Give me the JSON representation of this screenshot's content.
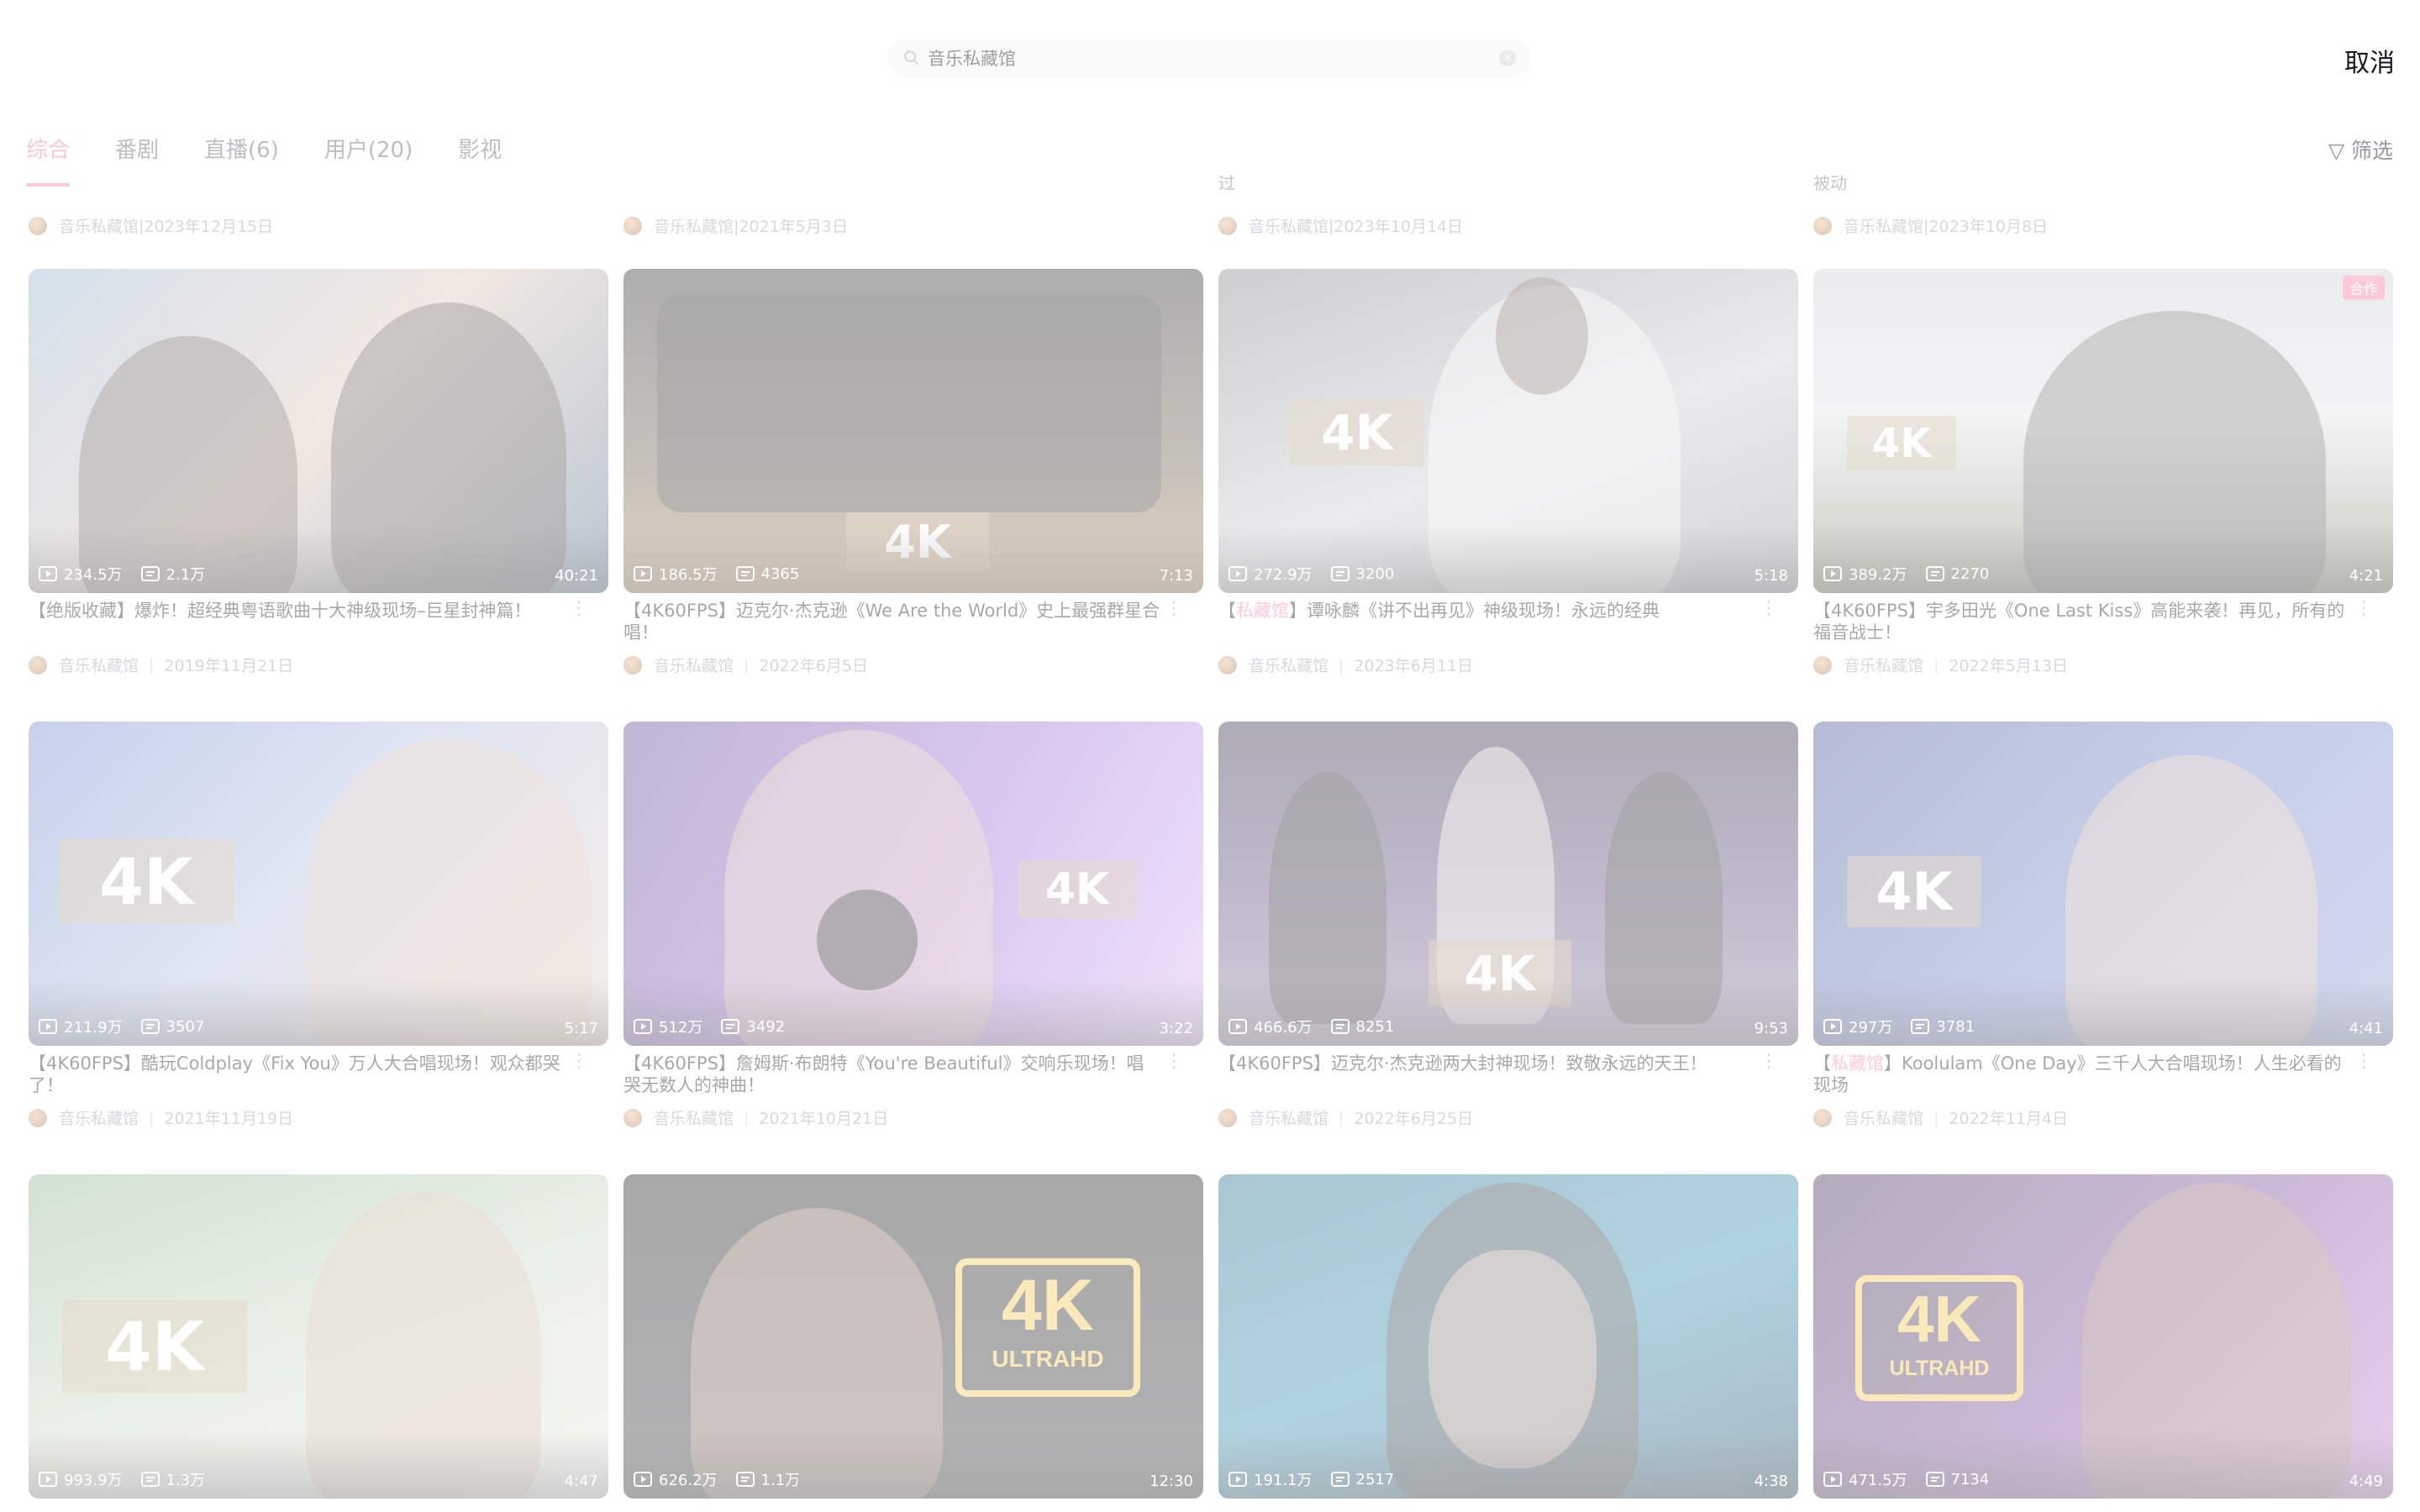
{
  "search": {
    "query": "音乐私藏馆",
    "cancel_label": "取消"
  },
  "tabs": [
    {
      "label": "综合",
      "active": true
    },
    {
      "label": "番剧"
    },
    {
      "label": "直播(6)"
    },
    {
      "label": "用户(20)"
    },
    {
      "label": "影视"
    }
  ],
  "filter_label": "▽ 筛选",
  "previous_row": {
    "title_tails": [
      "",
      "",
      "过",
      "被动"
    ],
    "meta": [
      {
        "author": "音乐私藏馆",
        "date": "2023年12月15日"
      },
      {
        "author": "音乐私藏馆",
        "date": "2021年5月3日"
      },
      {
        "author": "音乐私藏馆",
        "date": "2023年10月14日"
      },
      {
        "author": "音乐私藏馆",
        "date": "2023年10月8日"
      }
    ]
  },
  "videos": [
    {
      "plays": "234.5万",
      "danmaku": "2.1万",
      "duration": "40:21",
      "title_highlight": "",
      "title": "【绝版收藏】爆炸！超经典粤语歌曲十大神级现场–巨星封神篇！",
      "author": "音乐私藏馆",
      "date": "2019年11月21日",
      "icon": "more-icon",
      "badge": ""
    },
    {
      "plays": "186.5万",
      "danmaku": "4365",
      "duration": "7:13",
      "title_highlight": "",
      "title": "【4K60FPS】迈克尔·杰克逊《We Are the World》史上最强群星合唱！",
      "author": "音乐私藏馆",
      "date": "2022年6月5日",
      "badge": ""
    },
    {
      "plays": "272.9万",
      "danmaku": "3200",
      "duration": "5:18",
      "title_highlight": "私藏馆",
      "title": "】谭咏麟《讲不出再见》神级现场！永远的经典",
      "author": "音乐私藏馆",
      "date": "2023年6月11日",
      "badge": ""
    },
    {
      "plays": "389.2万",
      "danmaku": "2270",
      "duration": "4:21",
      "title_highlight": "",
      "title": "【4K60FPS】宇多田光《One Last Kiss》高能来袭！再见，所有的福音战士！",
      "author": "音乐私藏馆",
      "date": "2022年5月13日",
      "badge": "合作"
    },
    {
      "plays": "211.9万",
      "danmaku": "3507",
      "duration": "5:17",
      "title_highlight": "",
      "title": "【4K60FPS】酷玩Coldplay《Fix You》万人大合唱现场！观众都哭了！",
      "author": "音乐私藏馆",
      "date": "2021年11月19日",
      "badge": ""
    },
    {
      "plays": "512万",
      "danmaku": "3492",
      "duration": "3:22",
      "title_highlight": "",
      "title": "【4K60FPS】詹姆斯·布朗特《You're Beautiful》交响乐现场！唱哭无数人的神曲！",
      "author": "音乐私藏馆",
      "date": "2021年10月21日",
      "badge": ""
    },
    {
      "plays": "466.6万",
      "danmaku": "8251",
      "duration": "9:53",
      "title_highlight": "",
      "title": "【4K60FPS】迈克尔·杰克逊两大封神现场！致敬永远的天王！",
      "author": "音乐私藏馆",
      "date": "2022年6月25日",
      "badge": ""
    },
    {
      "plays": "297万",
      "danmaku": "3781",
      "duration": "4:41",
      "title_highlight": "私藏馆",
      "title": "】Koolulam《One Day》三千人大合唱现场！人生必看的现场",
      "author": "音乐私藏馆",
      "date": "2022年11月4日",
      "badge": ""
    },
    {
      "plays": "993.9万",
      "danmaku": "1.3万",
      "duration": "4:47",
      "title_highlight": "",
      "title": "",
      "author": "",
      "date": "",
      "badge": ""
    },
    {
      "plays": "626.2万",
      "danmaku": "1.1万",
      "duration": "12:30",
      "title_highlight": "",
      "title": "",
      "author": "",
      "date": "",
      "badge": ""
    },
    {
      "plays": "191.1万",
      "danmaku": "2517",
      "duration": "4:38",
      "title_highlight": "",
      "title": "",
      "author": "",
      "date": "",
      "badge": ""
    },
    {
      "plays": "471.5万",
      "danmaku": "7134",
      "duration": "4:49",
      "title_highlight": "",
      "title": "",
      "author": "",
      "date": "",
      "badge": ""
    }
  ],
  "watermark_text": "4K",
  "uhd_text_top": "4K",
  "uhd_text_bottom": "ULTRAHD",
  "colors": {
    "accent": "#fb7299",
    "text_secondary": "#9499a0"
  }
}
